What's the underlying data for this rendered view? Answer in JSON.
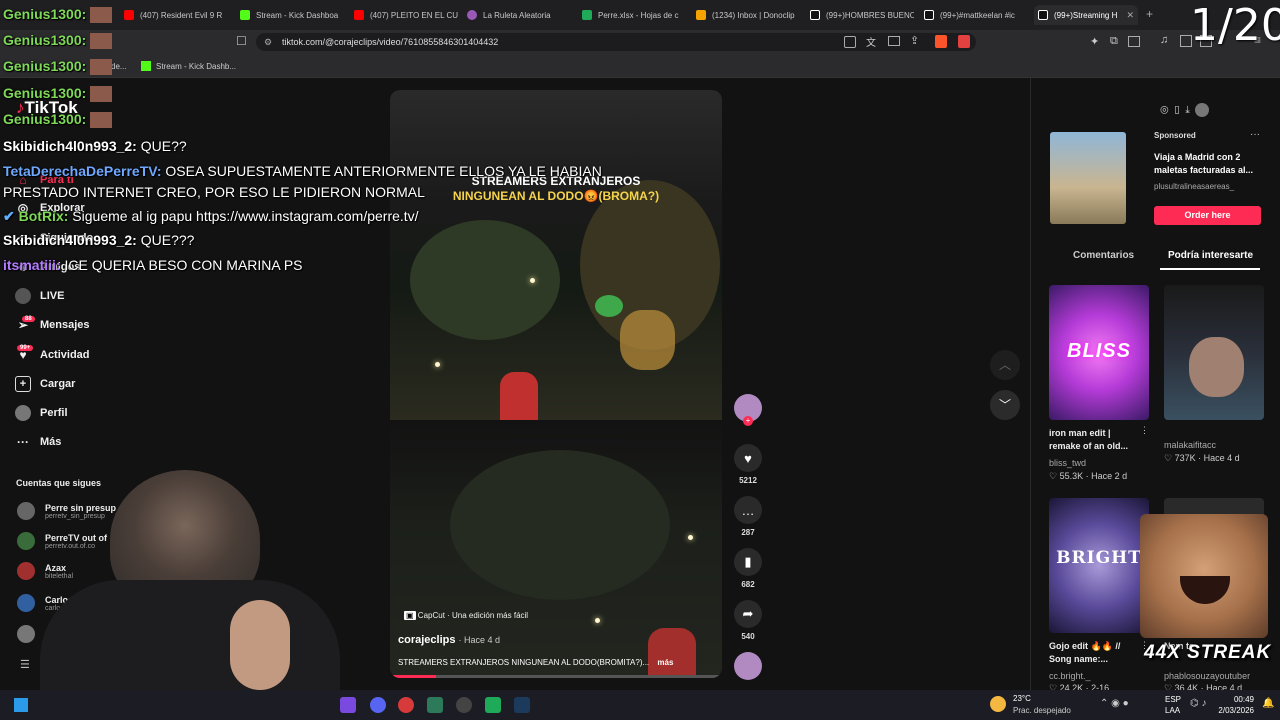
{
  "browser": {
    "tabs": [
      {
        "label": "(407) Resident Evil 9 R",
        "color": "#ff0000"
      },
      {
        "label": "Stream - Kick Dashboa",
        "color": "#53fc18"
      },
      {
        "label": "(407) PLEITO EN EL CU",
        "color": "#ff0000"
      },
      {
        "label": "La Ruleta Aleatoria",
        "color": "#9b59b6"
      },
      {
        "label": "Perre.xlsx - Hojas de c",
        "color": "#1faa59"
      },
      {
        "label": "(1234) Inbox | Donoclip",
        "color": "#f4a300"
      },
      {
        "label": "(99+)HOMBRES BUENO",
        "color": "#ffffff"
      },
      {
        "label": "(99+)#mattkeelan #ic",
        "color": "#ffffff"
      },
      {
        "label": "(99+)Streaming H",
        "color": "#ffffff"
      }
    ],
    "url": "tiktok.com/@corajeclips/video/7610855846301404432",
    "bookmarks": [
      {
        "label": "de...",
        "color": "#888888"
      },
      {
        "label": "Stream - Kick Dashb...",
        "color": "#53fc18"
      }
    ]
  },
  "tiktok": {
    "logo": "TikTok",
    "nav": [
      {
        "label": "Para ti",
        "icon": "home-icon"
      },
      {
        "label": "Explorar",
        "icon": "compass-icon"
      },
      {
        "label": "Siguiendo",
        "icon": "following-icon"
      },
      {
        "label": "Amigos",
        "icon": "friends-icon"
      },
      {
        "label": "LIVE",
        "icon": "live-icon"
      },
      {
        "label": "Mensajes",
        "icon": "message-icon",
        "badge": "88"
      },
      {
        "label": "Actividad",
        "icon": "activity-icon",
        "badge": "99+"
      },
      {
        "label": "Cargar",
        "icon": "upload-icon"
      },
      {
        "label": "Perfil",
        "icon": "profile-icon"
      },
      {
        "label": "Más",
        "icon": "more-icon"
      }
    ],
    "following_title": "Cuentas que sigues",
    "following": [
      {
        "name": "Perre sin presup",
        "handle": "perretv_sin_presup"
      },
      {
        "name": "PerreTV out of",
        "handle": "perretv.out.of.co"
      },
      {
        "name": "Azax",
        "handle": "bitelethal"
      },
      {
        "name": "Carlos Vela D",
        "handle": "carlosvela"
      },
      {
        "name": "",
        "handle": ""
      }
    ],
    "video": {
      "title_line1": "STREAMERS EXTRANJEROS",
      "title_line2": "NINGUNEAN AL DODO😡(BROMA?)",
      "capcut": "CapCut · Una edición más fácil",
      "author": "corajeclips",
      "age": "· Hace 4 d",
      "caption": "STREAMERS EXTRANJEROS NINGUNEAN AL DODO(BROMITA?)...",
      "more": "más"
    },
    "actions": {
      "likes": "5212",
      "comments": "287",
      "saves": "682",
      "shares": "540"
    },
    "ad": {
      "sponsored": "Sponsored",
      "title": "Viaja a Madrid con 2 maletas facturadas al...",
      "advertiser": "plusultralineasaereas_",
      "cta": "Order here"
    },
    "tabs": {
      "comments": "Comentarios",
      "related": "Podría interesarte"
    },
    "related": [
      {
        "title": "iron man edit | remake of an old...",
        "author": "bliss_twd",
        "stats": "♡ 55.3K · Hace 2 d",
        "thumb_text": "BLISS"
      },
      {
        "title": "",
        "author": "malakaifitacc",
        "stats": "♡ 737K · Hace 4 d",
        "thumb_text": ""
      },
      {
        "title": "Gojo edit 🔥🔥 // Song name:...",
        "author": "cc.bright._",
        "stats": "♡ 24.2K · 2-16",
        "thumb_text": "BRIGHT"
      },
      {
        "title": "Nem te",
        "author": "phablosouzayoutuber",
        "stats": "♡ 36.4K · Hace 4 d",
        "thumb_text": ""
      }
    ]
  },
  "chat": [
    {
      "user": "Genius1300:",
      "msg": "",
      "color": "#7ed957"
    },
    {
      "user": "Genius1300:",
      "msg": "",
      "color": "#7ed957"
    },
    {
      "user": "Genius1300:",
      "msg": "",
      "color": "#7ed957"
    },
    {
      "user": "Genius1300:",
      "msg": "",
      "color": "#7ed957"
    },
    {
      "user": "Genius1300:",
      "msg": "",
      "color": "#7ed957"
    },
    {
      "user": "Skibidich4l0n993_2:",
      "msg": "QUE??",
      "color": "#ffffff"
    },
    {
      "user": "TetaDerechaDePerreTV:",
      "msg": "OSEA SUPUESTAMENTE ANTERIORMENTE ELLOS YA LE HABIAN",
      "color": "#6fa8ff"
    },
    {
      "user": "",
      "msg": "PRESTADO INTERNET CREO, POR ESO LE PIDIERON NORMAL",
      "color": "#ffffff"
    },
    {
      "user": "BotRix:",
      "msg": "Sigueme al ig papu https://www.instagram.com/perre.tv/",
      "color": "#7ed957"
    },
    {
      "user": "Skibidich4l0n993_2:",
      "msg": "QUE???",
      "color": "#ffffff"
    },
    {
      "user": "itsmatiii:",
      "msg": "ICE QUERIA BESO CON MARINA PS",
      "color": "#b57bff"
    }
  ],
  "overlay": {
    "counter": "1/20",
    "streak": "44X STREAK"
  },
  "taskbar": {
    "weather_temp": "23°C",
    "weather_desc": "Prac. despejado",
    "lang1": "ESP",
    "lang2": "LAA",
    "time": "00:49",
    "date": "2/03/2026"
  },
  "colors": {
    "tiktok_red": "#fe2c55",
    "background": "#121212"
  }
}
